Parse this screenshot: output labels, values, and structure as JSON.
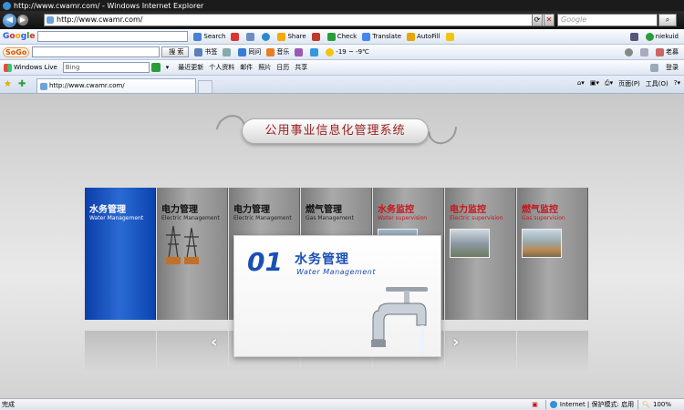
{
  "window": {
    "title": "http://www.cwamr.com/ - Windows Internet Explorer"
  },
  "address_bar": {
    "url": "http://www.cwamr.com/",
    "search_placeholder": "Google"
  },
  "google_toolbar": {
    "logo": "Google",
    "items": [
      "Search",
      "Share",
      "Check",
      "Translate",
      "AutoFill"
    ],
    "user": "niekuid"
  },
  "sogou_toolbar": {
    "logo": "SoGo",
    "search_button": "搜 索",
    "items": [
      "书签",
      "同问",
      "音乐"
    ],
    "weather": "-19 ~ -9℃",
    "right_label": "老募"
  },
  "live_toolbar": {
    "logo": "Windows Live",
    "search_value": "Bing",
    "links": [
      "最近更新",
      "个人资料",
      "邮件",
      "照片",
      "日历",
      "共享"
    ],
    "signin": "登录"
  },
  "tab_bar": {
    "tab_title": "http://www.cwamr.com/",
    "tools": [
      "页面(P)",
      "工具(O)"
    ]
  },
  "page": {
    "banner_title": "公用事业信息化管理系统",
    "panels": [
      {
        "title": "水务管理",
        "subtitle": "Water Management",
        "style": "blue"
      },
      {
        "title": "电力管理",
        "subtitle": "Electric Management",
        "style": "gray"
      },
      {
        "title": "电力管理",
        "subtitle": "Electric Management",
        "style": "gray"
      },
      {
        "title": "燃气管理",
        "subtitle": "Gas Management",
        "style": "gray"
      },
      {
        "title": "水务监控",
        "subtitle": "Water supervision",
        "style": "red"
      },
      {
        "title": "电力监控",
        "subtitle": "Electric supervision",
        "style": "red"
      },
      {
        "title": "燃气监控",
        "subtitle": "Gas supervision",
        "style": "red"
      }
    ],
    "featured": {
      "number": "01",
      "title": "水务管理",
      "subtitle": "Water Management"
    },
    "prev_arrow": "‹",
    "next_arrow": "›"
  },
  "status_bar": {
    "left": "完成",
    "zone": "Internet | 保护模式: 启用",
    "zoom": "100%"
  },
  "colors": {
    "accent_blue": "#1a4fb5",
    "title_red": "#9c1c1c",
    "panel_red_text": "#c8141a"
  }
}
